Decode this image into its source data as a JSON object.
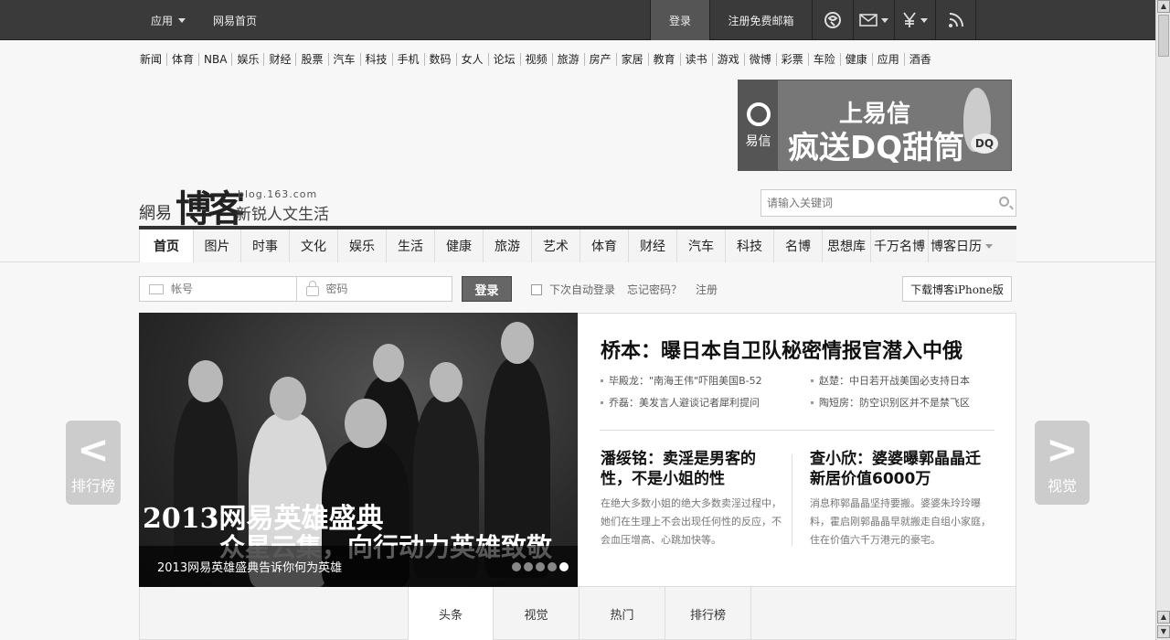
{
  "topbar": {
    "app": "应用",
    "home": "网易首页",
    "login": "登录",
    "register_mail": "注册免费邮箱"
  },
  "channels": [
    "新闻",
    "体育",
    "NBA",
    "娱乐",
    "财经",
    "股票",
    "汽车",
    "科技",
    "手机",
    "数码",
    "女人",
    "论坛",
    "视频",
    "旅游",
    "房产",
    "家居",
    "教育",
    "读书",
    "游戏",
    "微博",
    "彩票",
    "车险",
    "健康",
    "应用",
    "酒香"
  ],
  "ad": {
    "brand": "易信",
    "line1": "上易信",
    "line2": "疯送DQ甜筒",
    "badge": "DQ"
  },
  "brand": {
    "netease": "網易",
    "blog": "博客",
    "url": "blog.163.com",
    "slogan": "新锐人文生活"
  },
  "search": {
    "placeholder": "请输入关键词"
  },
  "nav": [
    "首页",
    "图片",
    "时事",
    "文化",
    "娱乐",
    "生活",
    "健康",
    "旅游",
    "艺术",
    "体育",
    "财经",
    "汽车",
    "科技",
    "名博",
    "思想库",
    "千万名博",
    "博客日历"
  ],
  "login_form": {
    "account_placeholder": "帐号",
    "password_placeholder": "密码",
    "login_button": "登录",
    "remember": "下次自动登录",
    "forgot": "忘记密码？",
    "register": "注册",
    "iphone": "下载博客iPhone版"
  },
  "slide": {
    "title_line1": "2013网易英雄盛典",
    "title_line2": "众星云集，向行动力英雄致敬",
    "caption": "2013网易英雄盛典告诉你何为英雄",
    "dots": 5,
    "active_dot": 5
  },
  "headline": {
    "title": "桥本：曝日本自卫队秘密情报官潜入中俄",
    "links": [
      "毕殿龙：\"南海王伟\"吓阻美国B-52",
      "赵楚：中日若开战美国必支持日本",
      "乔磊：美发言人避谈记者犀利提问",
      "陶短房：防空识别区并不是禁飞区"
    ]
  },
  "stories": [
    {
      "title": "潘绥铭：卖淫是男客的性，不是小姐的性",
      "body": "在绝大多数小姐的绝大多数卖淫过程中，她们在生理上不会出现任何性的反应，不会血压增高、心跳加快等。"
    },
    {
      "title": "查小欣：婆婆曝郭晶晶迁新居价值6000万",
      "body": "消息称郭晶晶坚持要搬。婆婆朱玲玲曝料，霍启刚郭晶晶早就搬走自组小家庭，住在价值六千万港元的豪宅。"
    }
  ],
  "side": {
    "left": {
      "chevron": "<",
      "label": "排行榜"
    },
    "right": {
      "chevron": ">",
      "label": "视觉"
    }
  },
  "tabs": [
    "头条",
    "视觉",
    "热门",
    "排行榜"
  ]
}
